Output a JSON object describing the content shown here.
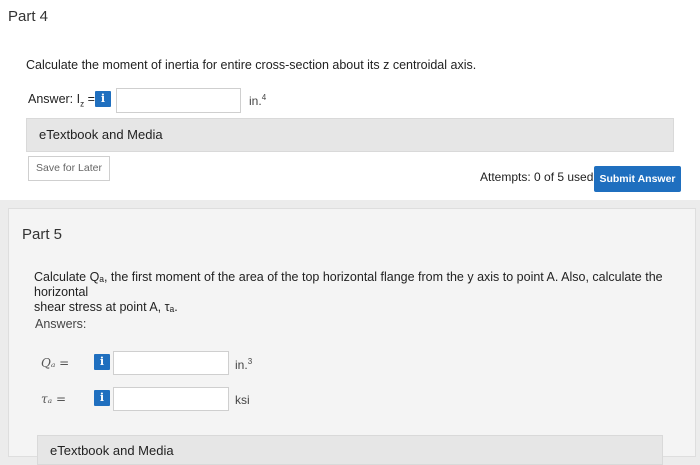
{
  "part4": {
    "title": "Part 4",
    "question": "Calculate the moment of inertia for entire cross-section about its z centroidal axis.",
    "answer_label": "Answer: I",
    "answer_sub": "z",
    "answer_eq": " =",
    "info_glyph": "i",
    "input_value": "",
    "unit": "in.",
    "unit_sup": "4",
    "etextbook": "eTextbook and Media",
    "save_label": "Save for Later",
    "attempts": "Attempts: 0 of 5 used",
    "submit_label": "Submit Answer"
  },
  "part5": {
    "title": "Part 5",
    "question_line1": "Calculate Qₐ, the first moment of the area of the top horizontal flange from the y axis to point A. Also, calculate the horizontal",
    "question_line2": "shear stress at point A, τₐ.",
    "answers_label": "Answers:",
    "q_label": "Qₐ =",
    "q_value": "",
    "q_unit": "in.",
    "q_unit_sup": "3",
    "tau_label": "τₐ =",
    "tau_value": "",
    "tau_unit": "ksi",
    "info_glyph": "i",
    "etextbook": "eTextbook and Media"
  },
  "colors": {
    "accent": "#1f6fbf",
    "page_bg": "#ececec",
    "panel_bg": "#ffffff"
  }
}
